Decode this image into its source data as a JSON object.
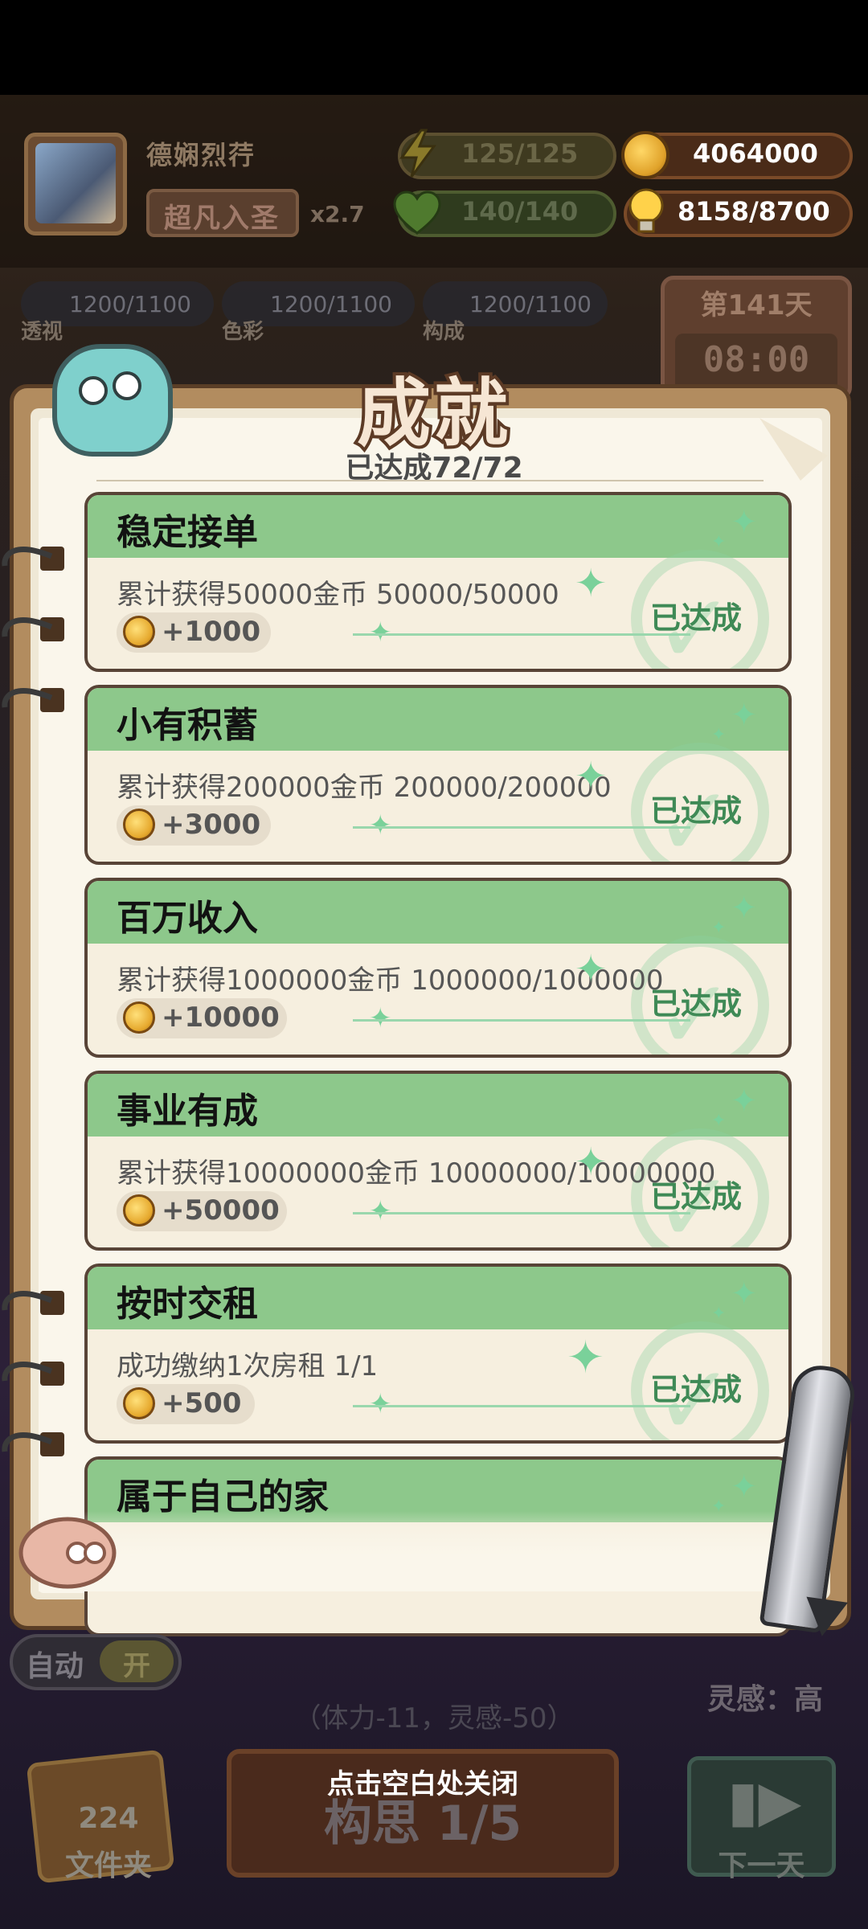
{
  "player": {
    "name": "德娴烈荇",
    "rank": "超凡入圣",
    "multiplier": "x2.7"
  },
  "resources": {
    "energy": "125/125",
    "health": "140/140",
    "coins": "4064000",
    "inspiration_points": "8158/8700"
  },
  "stats": [
    {
      "value": "1200/1100",
      "label": "透视"
    },
    {
      "value": "1200/1100",
      "label": "色彩"
    },
    {
      "value": "1200/1100",
      "label": "构成"
    }
  ],
  "day": {
    "title": "第141天",
    "time": "08:00"
  },
  "achievements_panel": {
    "title": "成就",
    "progress": "已达成72/72",
    "items": [
      {
        "title": "稳定接单",
        "description": "累计获得50000金币 50000/50000",
        "reward": "+1000",
        "status": "已达成"
      },
      {
        "title": "小有积蓄",
        "description": "累计获得200000金币 200000/200000",
        "reward": "+3000",
        "status": "已达成"
      },
      {
        "title": "百万收入",
        "description": "累计获得1000000金币 1000000/1000000",
        "reward": "+10000",
        "status": "已达成"
      },
      {
        "title": "事业有成",
        "description": "累计获得10000000金币 10000000/10000000",
        "reward": "+50000",
        "status": "已达成"
      },
      {
        "title": "按时交租",
        "description": "成功缴纳1次房租 1/1",
        "reward": "+500",
        "status": "已达成"
      },
      {
        "title": "属于自己的家",
        "description": "",
        "reward": "",
        "status": ""
      }
    ]
  },
  "bottom": {
    "auto_label": "自动",
    "auto_state": "开",
    "inspiration_status": "灵感：高",
    "cost_text": "（体力-11，灵感-50）",
    "main_button": "构思 1/5",
    "close_hint": "点击空白处关闭",
    "folder_count": "224",
    "folder_label": "文件夹",
    "next_day_label": "下一天"
  },
  "colors": {
    "card_header": "#8dc88b",
    "card_body": "#f6efdf",
    "notebook_frame": "#b28c5f",
    "completed_text": "#3f8a56"
  }
}
